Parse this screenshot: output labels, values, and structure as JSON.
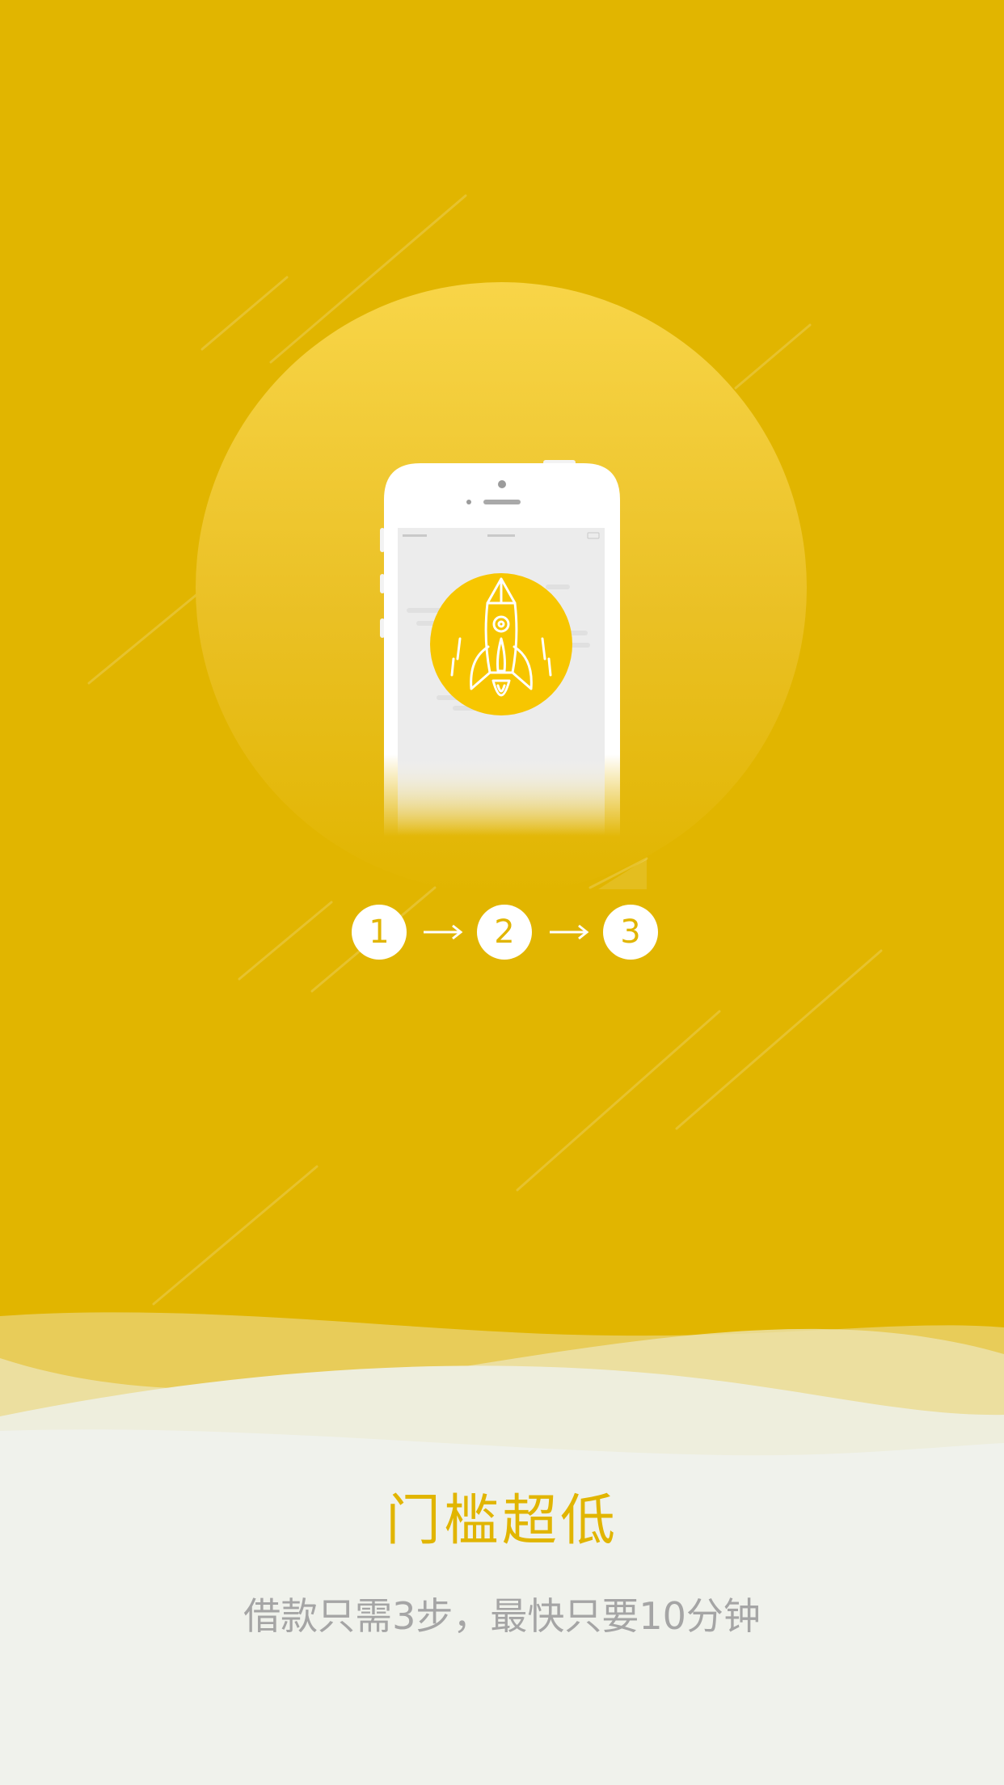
{
  "colors": {
    "background": "#E1B500",
    "circle_top": "#F8D548",
    "circle_bottom": "#E1B500",
    "rocket_circle": "#F7C600",
    "bottom_panel": "#F0F2EC",
    "step_bg": "#FFFFFF",
    "text_primary": "#E1B500",
    "text_secondary": "#A5A5A5"
  },
  "illustration": {
    "phone_icon": "phone-icon",
    "rocket_icon": "rocket-icon"
  },
  "steps": [
    "1",
    "2",
    "3"
  ],
  "headline": "门槛超低",
  "subheadline": "借款只需3步，最快只要10分钟"
}
